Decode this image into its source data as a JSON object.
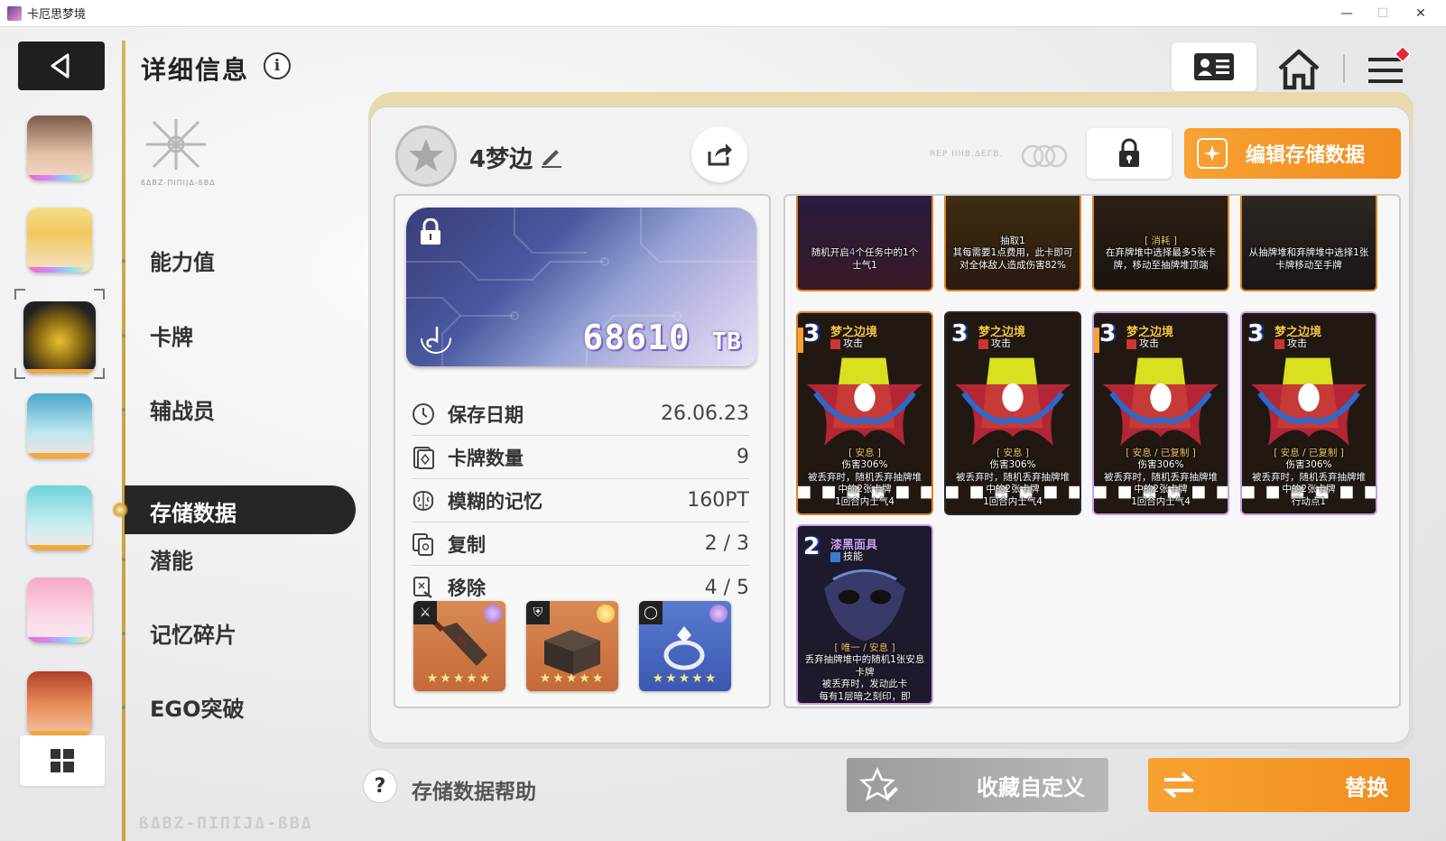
{
  "window": {
    "title": "卡厄思梦境",
    "minimize": "—",
    "maximize": "☐",
    "close": "✕"
  },
  "header": {
    "title": "详细信息",
    "info_label": "i"
  },
  "logo_sub": "ßΔBZ-ΠIΠIJΔ-ßBΔ",
  "menu": {
    "items": [
      "能力值",
      "卡牌",
      "辅战员",
      "存储数据",
      "潜能",
      "记忆碎片",
      "EGO突破"
    ],
    "active": "存储数据"
  },
  "save": {
    "name": "4梦边",
    "edit_button": "编辑存储数据",
    "faint_label": "REP IIIIB.ΔEГB.",
    "tb_value": "68610",
    "tb_unit": "TB",
    "stats": [
      {
        "icon": "clock-icon",
        "label": "保存日期",
        "value": "26.06.23"
      },
      {
        "icon": "card-count-icon",
        "label": "卡牌数量",
        "value": "9"
      },
      {
        "icon": "brain-icon",
        "label": "模糊的记忆",
        "value": "160PT"
      },
      {
        "icon": "copy-icon",
        "label": "复制",
        "value": "2 / 3"
      },
      {
        "icon": "remove-icon",
        "label": "移除",
        "value": "4 / 5"
      }
    ],
    "equipment": [
      {
        "icon": "sword-icon",
        "item": "cleaver",
        "stars": "★★★★★",
        "gem": "#9b6ad0"
      },
      {
        "icon": "armor-icon",
        "item": "box",
        "stars": "★★★★★",
        "gem": "#f7b733"
      },
      {
        "icon": "ring-icon",
        "item": "ring",
        "stars": "★★★★★",
        "gem": "#9b6ad0"
      }
    ]
  },
  "cards_top": [
    {
      "desc1": "随机开启",
      "hl": "4",
      "desc2": "个任务中的1个",
      "desc3": "士气1"
    },
    {
      "desc1": "抽取1",
      "desc2": "其每需要1点费用，此卡即可对全体敌人造成伤害82%",
      "desc3": ""
    },
    {
      "kw": "[ 消耗 ]",
      "desc2": "在弃牌堆中选择最多5张卡牌，移动至抽牌堆顶端",
      "desc3": ""
    },
    {
      "desc2": "从抽牌堆和弃牌堆中选择1张卡牌移动至手牌",
      "desc3": ""
    }
  ],
  "cards_mid": [
    {
      "cost": "3",
      "name": "梦之边境",
      "type": "攻击",
      "kw": "[ 安息 ]",
      "l1": "伤害306%",
      "l2": "被丢弃时，随机丢弃抽牌堆中的2张卡牌",
      "l3": "1回合内士气4"
    },
    {
      "cost": "3",
      "name": "梦之边境",
      "type": "攻击",
      "kw": "[ 安息 ]",
      "l1": "伤害306%",
      "l2": "被丢弃时，随机丢弃抽牌堆中的2张卡牌",
      "l3": "1回合内士气4"
    },
    {
      "cost": "3",
      "name": "梦之边境",
      "type": "攻击",
      "kw": "[ 安息 / 已复制 ]",
      "l1": "伤害306%",
      "l2": "被丢弃时，随机丢弃抽牌堆中的2张卡牌",
      "l3": "1回合内士气4"
    },
    {
      "cost": "3",
      "name": "梦之边境",
      "type": "攻击",
      "kw": "[ 安息 / 已复制 ]",
      "l1": "伤害306%",
      "l2": "被丢弃时，随机丢弃抽牌堆中的2张卡牌",
      "l3": "行动点1"
    }
  ],
  "card_bottom": {
    "cost": "2",
    "name": "漆黑面具",
    "type": "技能",
    "kw": "[ 唯一 / 安息 ]",
    "l1": "丢弃抽牌堆中的随机1张安息卡牌",
    "l2": "被丢弃时，发动此卡",
    "l3": "每有1层暗之刻印，即"
  },
  "footer": {
    "help": "存储数据帮助",
    "favorite": "收藏自定义",
    "replace": "替换",
    "logo": "ßΔBZ-ΠIΠIJΔ-ßBΔ"
  },
  "colors": {
    "accent": "#f28d1e",
    "gold": "#c9a440",
    "dark": "#262626"
  }
}
